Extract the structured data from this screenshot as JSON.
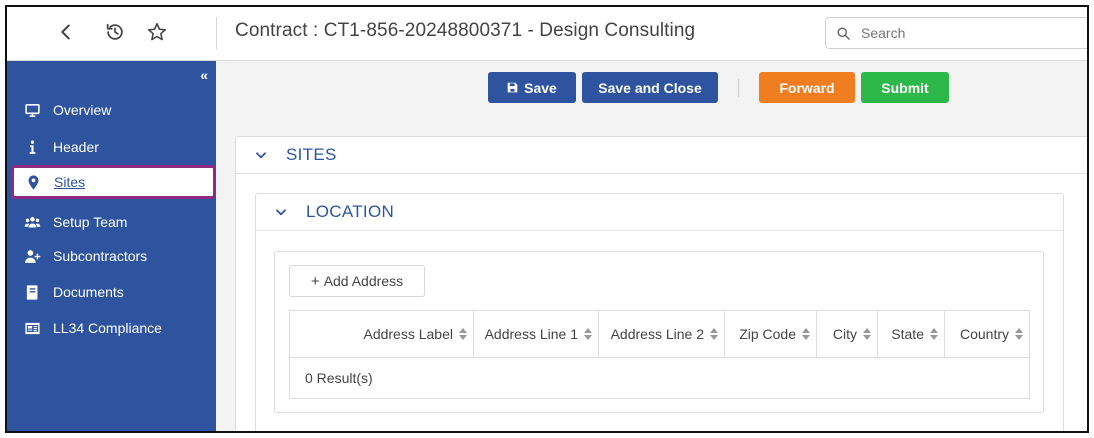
{
  "header": {
    "title": "Contract : CT1-856-20248800371 - Design Consulting",
    "search_placeholder": "Search"
  },
  "sidebar": {
    "items": [
      {
        "label": "Overview",
        "icon": "monitor-icon"
      },
      {
        "label": "Header",
        "icon": "info-icon"
      },
      {
        "label": "Sites",
        "icon": "map-pin-icon",
        "active": true
      },
      {
        "label": "Setup Team",
        "icon": "users-icon"
      },
      {
        "label": "Subcontractors",
        "icon": "user-plus-icon"
      },
      {
        "label": "Documents",
        "icon": "book-icon"
      },
      {
        "label": "LL34 Compliance",
        "icon": "id-card-icon"
      }
    ]
  },
  "toolbar": {
    "save_label": "Save",
    "save_close_label": "Save and Close",
    "forward_label": "Forward",
    "submit_label": "Submit"
  },
  "colors": {
    "primary": "#2e54a0",
    "forward": "#f07d1f",
    "submit": "#2db84a",
    "active_outline": "#8e2a7f"
  },
  "sites_panel": {
    "title": "SITES",
    "location": {
      "title": "LOCATION",
      "add_address_label": "Add Address",
      "columns": [
        "Address Label",
        "Address Line 1",
        "Address Line 2",
        "Zip Code",
        "City",
        "State",
        "Country"
      ],
      "result_text": "0 Result(s)"
    }
  }
}
